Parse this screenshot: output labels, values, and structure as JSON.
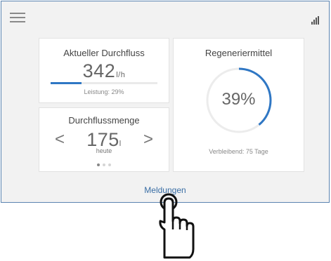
{
  "header": {
    "menu_icon": "hamburger-menu-icon",
    "signal_icon": "signal-strength-icon"
  },
  "flow_card": {
    "title": "Aktueller Durchfluss",
    "value": "342",
    "unit": "l/h",
    "power_label": "Leistung: 29%",
    "power_fraction": 0.29
  },
  "amount_card": {
    "title": "Durchflussmenge",
    "value": "175",
    "unit": "l",
    "period": "heute",
    "prev_icon": "chevron-left-icon",
    "next_icon": "chevron-right-icon",
    "page_count": 3,
    "active_page": 1
  },
  "regen_card": {
    "title": "Regeneriermittel",
    "percent_label": "39%",
    "fraction": 0.39,
    "remaining": "Verbleibend: 75 Tage"
  },
  "footer": {
    "messages_link": "Meldungen"
  },
  "colors": {
    "accent": "#2f77c4",
    "border": "#5b84b1",
    "background": "#f2f2f2"
  },
  "overlay": {
    "icon": "pointing-hand-cursor-icon"
  }
}
